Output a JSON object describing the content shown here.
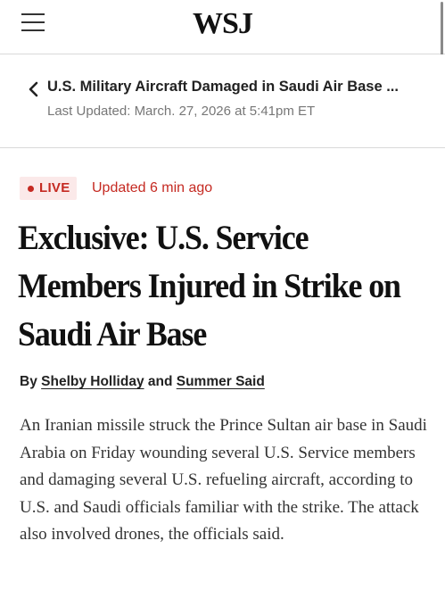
{
  "header": {
    "logo": "WSJ",
    "menu_icon": "hamburger-menu-icon"
  },
  "live_banner": {
    "back_icon": "chevron-left-icon",
    "title": "U.S. Military Aircraft Damaged in Saudi Air Base ...",
    "last_updated": "Last Updated: March. 27, 2026 at 5:41pm ET"
  },
  "article": {
    "live_label": "LIVE",
    "updated_ago": "Updated 6 min ago",
    "headline": "Exclusive: U.S. Service Members Injured in Strike on Saudi Air Base",
    "byline": {
      "by": "By",
      "author1": "Shelby Holliday",
      "and": "and",
      "author2": "Summer Said"
    },
    "body": "An Iranian missile struck the Prince Sultan air base in Saudi Arabia on Friday wounding several U.S. Service members and damaging several U.S. refueling aircraft, according to U.S. and Saudi officials familiar with the strike. The attack also involved drones, the officials said."
  },
  "colors": {
    "live_red": "#c52a22",
    "live_badge_bg": "#fbe9e9",
    "text_dark": "#111111",
    "text_muted": "#777777",
    "divider": "#d9d9d9"
  }
}
